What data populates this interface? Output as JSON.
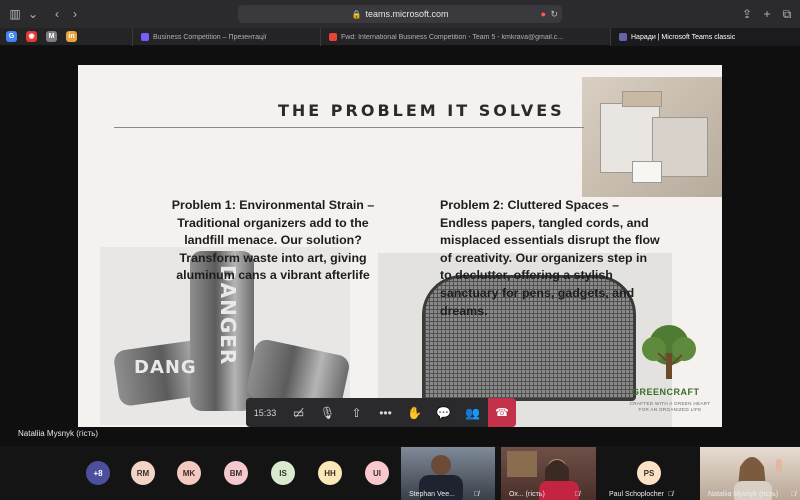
{
  "browser": {
    "url": "teams.microsoft.com",
    "tabs": [
      {
        "title": "Business Competition – Презентації",
        "fav_color": "#7b5cff"
      },
      {
        "title": "Fwd: International Business Competition - Team 5 - kmkrava@gmail.c...",
        "fav_color": "#ea4335"
      },
      {
        "title": "Наради | Microsoft Teams classic",
        "fav_color": "#6264a7"
      }
    ],
    "pins": [
      {
        "label": "G",
        "color": "#4285f4"
      },
      {
        "label": "◉",
        "color": "#e53935"
      },
      {
        "label": "M",
        "color": "#7e7e86"
      },
      {
        "label": "in",
        "color": "#e8a33d"
      }
    ]
  },
  "slide": {
    "title": "THE PROBLEM IT SOLVES",
    "problem1": "Problem 1: Environmental Strain – Traditional organizers add to the landfill menace. Our solution? Transform waste into art, giving aluminum cans a vibrant afterlife",
    "problem2": "Problem 2: Cluttered Spaces – Endless papers, tangled cords, and misplaced essentials disrupt the flow of creativity. Our organizers step in to declutter, offering a stylish sanctuary for pens, gadgets, and dreams.",
    "can_label_1": "DANGER",
    "can_label_2": "DANG",
    "brand_name": "GREENCRAFT",
    "brand_tagline": "CRAFTED WITH A GREEN HEART FOR AN ORGANIZED LIFE",
    "brand_color": "#3d6b29"
  },
  "call": {
    "timer": "15:33",
    "presenter": "Nataliia Mysnyk (гість)",
    "controls": [
      "camera-off-icon",
      "mic-off-icon",
      "share-icon",
      "more-icon",
      "raise-hand-icon",
      "chat-icon",
      "people-icon",
      "hang-up-icon"
    ],
    "hangup_color": "#c4314b"
  },
  "roster": {
    "overflow": "+8",
    "avatars": [
      {
        "initials": "RM",
        "color": "#f1d4c6"
      },
      {
        "initials": "MK",
        "color": "#f3c9c0"
      },
      {
        "initials": "BM",
        "color": "#f4c8cc"
      },
      {
        "initials": "IS",
        "color": "#d9ead0"
      },
      {
        "initials": "HH",
        "color": "#fbe7b8"
      },
      {
        "initials": "UI",
        "color": "#f7c9cd"
      }
    ],
    "tiles": [
      {
        "name": "Stephan Vee..."
      },
      {
        "name": "Ох... (гість)"
      },
      {
        "name": "Nataliia Mysnyk (гість)"
      }
    ],
    "ps": {
      "initials": "PS",
      "name": "Paul Schoplocher",
      "color": "#fbe2c6"
    }
  }
}
